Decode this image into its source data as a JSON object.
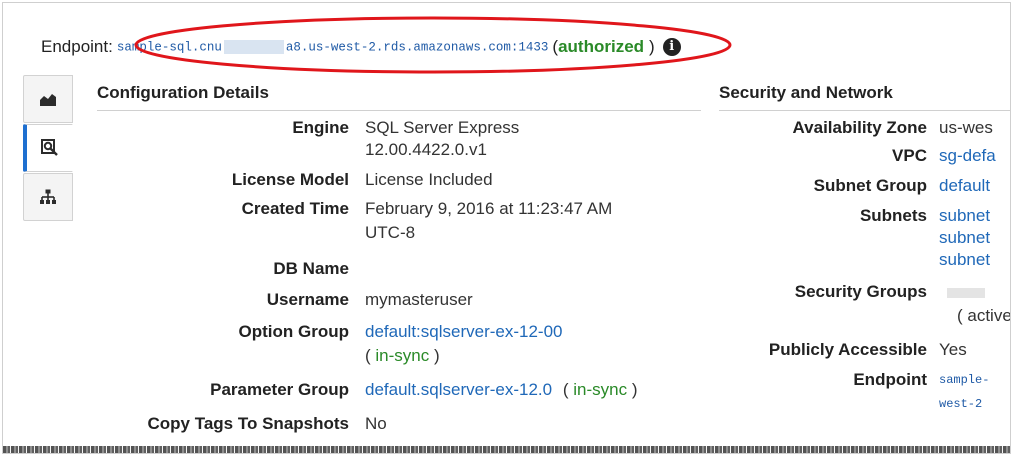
{
  "endpoint": {
    "label": "Endpoint:",
    "host_prefix": "sample-sql.cnu",
    "host_suffix": "a8.us-west-2.rds.amazonaws.com:1433",
    "status_paren_open": "(",
    "status": "authorized",
    "status_paren_close": ")",
    "info_icon": "info-icon"
  },
  "tabs": [
    {
      "icon": "monitoring-chart-icon",
      "active": false
    },
    {
      "icon": "details-magnifier-icon",
      "active": true
    },
    {
      "icon": "topology-icon",
      "active": false
    }
  ],
  "config": {
    "title": "Configuration Details",
    "engine": {
      "label": "Engine",
      "line1": "SQL Server Express",
      "line2": "12.00.4422.0.v1"
    },
    "license": {
      "label": "License Model",
      "value": "License Included"
    },
    "created": {
      "label": "Created Time",
      "line1": "February 9, 2016 at 11:23:47 AM",
      "line2": "UTC-8"
    },
    "dbname": {
      "label": "DB Name",
      "value": ""
    },
    "username": {
      "label": "Username",
      "value": "mymasteruser"
    },
    "option_group": {
      "label": "Option Group",
      "link": "default:sqlserver-ex-12-00",
      "paren_open": "(",
      "status": "in-sync",
      "paren_close": ")"
    },
    "parameter_group": {
      "label": "Parameter Group",
      "link": "default.sqlserver-ex-12.0",
      "paren_open": "(",
      "status": "in-sync",
      "paren_close": ")"
    },
    "copy_tags": {
      "label": "Copy Tags To Snapshots",
      "value": "No"
    }
  },
  "security": {
    "title": "Security and Network",
    "az": {
      "label": "Availability Zone",
      "value": "us-wes"
    },
    "vpc": {
      "label": "VPC",
      "value": "sg-defa"
    },
    "subnet_group": {
      "label": "Subnet Group",
      "value": "default"
    },
    "subnets": {
      "label": "Subnets",
      "values": [
        "subnet",
        "subnet",
        "subnet"
      ]
    },
    "security_groups": {
      "label": "Security Groups",
      "status": "( active"
    },
    "public": {
      "label": "Publicly Accessible",
      "value": "Yes"
    },
    "endpoint": {
      "label": "Endpoint",
      "line1": "sample-",
      "line2": "west-2"
    }
  },
  "colors": {
    "link": "#1f68b8",
    "status_green": "#2a8a28",
    "highlight_red": "#e0161b",
    "tab_accent": "#1e6fd0"
  }
}
